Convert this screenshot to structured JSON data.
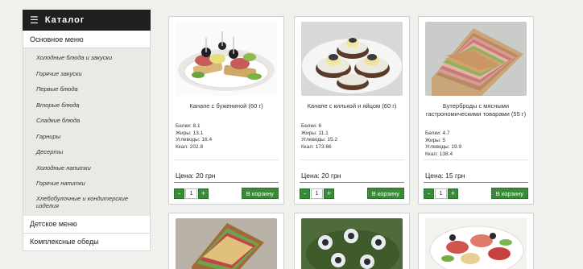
{
  "catalog": {
    "header": "Каталог",
    "main_menu": "Основное меню",
    "subitems": [
      "Холодные блюда и закуски",
      "Горячие закуски",
      "Первые блюда",
      "Вторые блюда",
      "Сладкие блюда",
      "Гарниры",
      "Десерты",
      "Холодные напитки",
      "Горячие напитки",
      "Хлебобулочные и кондитерские изделия"
    ],
    "kids_menu": "Детское меню",
    "complex_lunch": "Комплексные обеды"
  },
  "products": [
    {
      "name": "Канапе с бужениной (60 г)",
      "protein": "Белки: 8.1",
      "fat": "Жиры: 13.1",
      "carbs": "Углеводы: 16.4",
      "kcal": "Ккал: 202.8",
      "price": "Цена: 20 грн",
      "qty": "1",
      "cart": "В корзину"
    },
    {
      "name": "Канапе с килькой и яйцом (60 г)",
      "protein": "Белки: 6",
      "fat": "Жиры: 11.1",
      "carbs": "Углеводы: 15.2",
      "kcal": "Ккал: 173.66",
      "price": "Цена: 20 грн",
      "qty": "1",
      "cart": "В корзину"
    },
    {
      "name": "Бутерброды с мясными гастрономическими товарами (55 г)",
      "protein": "Белки: 4.7",
      "fat": "Жиры: 5",
      "carbs": "Углеводы: 19.9",
      "kcal": "Ккал: 138.4",
      "price": "Цена: 15 грн",
      "qty": "1",
      "cart": "В корзину"
    }
  ],
  "controls": {
    "minus": "-",
    "plus": "+"
  },
  "icons": {
    "menu": "hamburger-icon"
  },
  "colors": {
    "header_bg": "#1f1f1f",
    "button_green": "#3b8a3a"
  }
}
